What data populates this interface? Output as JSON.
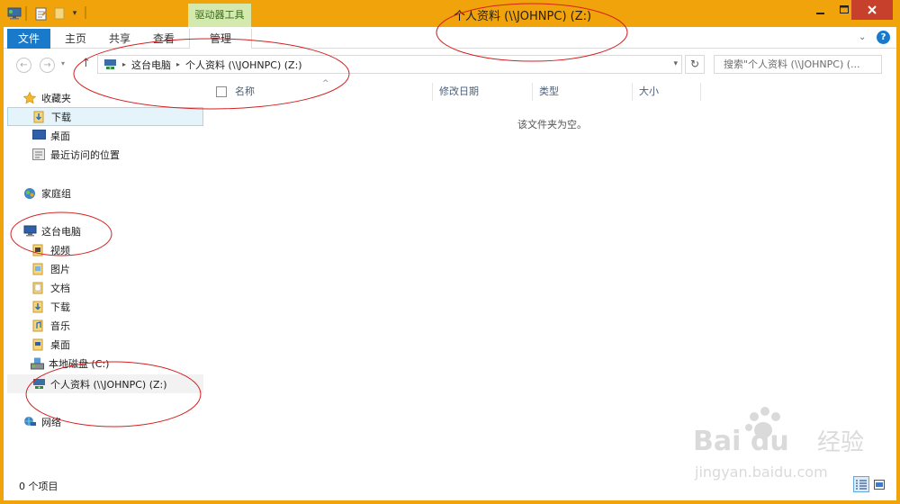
{
  "window": {
    "title": "个人资料 (\\\\JOHNPC) (Z:)",
    "contextual_tab": "驱动器工具"
  },
  "ribbon": {
    "file_tab": "文件",
    "tabs": [
      "主页",
      "共享",
      "查看",
      "管理"
    ]
  },
  "navbar": {
    "breadcrumb": [
      "这台电脑",
      "个人资料 (\\\\JOHNPC) (Z:)"
    ],
    "search_placeholder": "搜索\"个人资料 (\\\\JOHNPC) (..."
  },
  "navpane": {
    "favorites": {
      "label": "收藏夹",
      "items": [
        "下载",
        "桌面",
        "最近访问的位置"
      ]
    },
    "homegroup": "家庭组",
    "this_pc": {
      "label": "这台电脑",
      "items": [
        "视频",
        "图片",
        "文档",
        "下载",
        "音乐",
        "桌面",
        "本地磁盘 (C:)",
        "个人资料 (\\\\JOHNPC) (Z:)"
      ]
    },
    "network": "网络"
  },
  "columns": [
    "名称",
    "修改日期",
    "类型",
    "大小"
  ],
  "empty_message": "该文件夹为空。",
  "status": {
    "item_count": "0 个项目"
  },
  "watermark": {
    "brand": "Bai du",
    "chinese": "经验",
    "url": "jingyan.baidu.com"
  },
  "colors": {
    "accent": "#f0a30a",
    "file_tab": "#1979ca",
    "close": "#c7402b",
    "annotation": "#d42020"
  },
  "icons": [
    "computer-icon",
    "properties-icon",
    "folder-icon",
    "up-arrow-icon",
    "refresh-icon",
    "search-icon",
    "star-icon",
    "homegroup-icon",
    "network-icon",
    "drive-icon",
    "network-drive-icon"
  ]
}
